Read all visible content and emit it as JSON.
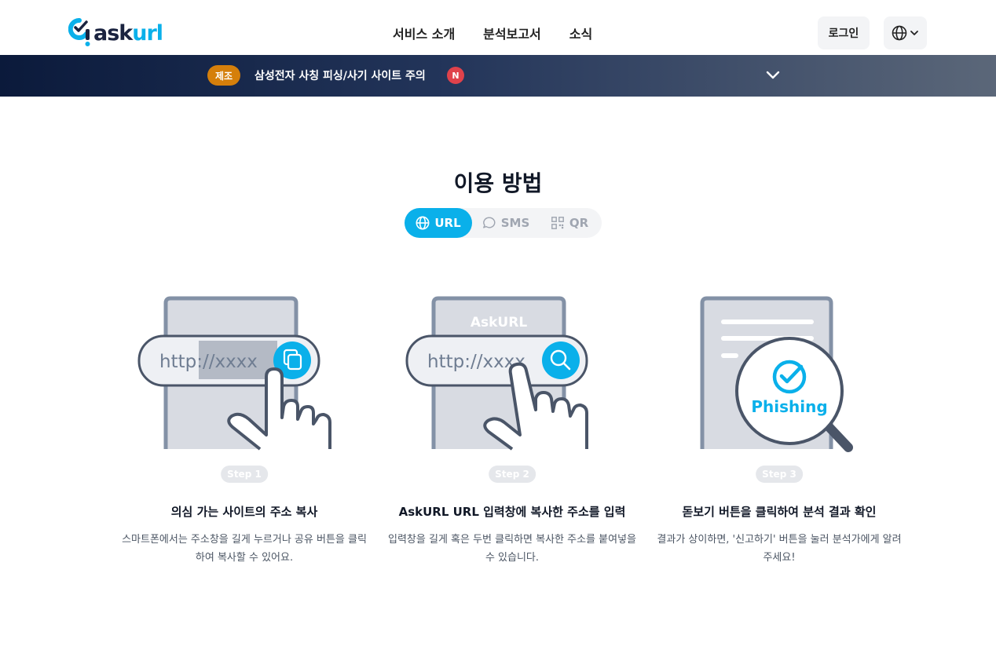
{
  "brand": {
    "logo_prefix": "ask",
    "logo_accent": "url",
    "accent_color": "#0ab0ea"
  },
  "nav": {
    "items": [
      "서비스 소개",
      "분석보고서",
      "소식"
    ]
  },
  "header": {
    "login_label": "로그인",
    "lang_icon": "globe-icon"
  },
  "banner": {
    "tag": "제조",
    "text": "삼성전자 사칭 피싱/사기 사이트 주의",
    "new_badge": "N"
  },
  "section": {
    "title": "이용 방법",
    "tabs": [
      {
        "label": "URL",
        "icon": "globe-icon",
        "active": true
      },
      {
        "label": "SMS",
        "icon": "chat-bubble-icon",
        "active": false
      },
      {
        "label": "QR",
        "icon": "qr-code-icon",
        "active": false
      }
    ]
  },
  "steps": [
    {
      "badge": "Step 1",
      "illus_text": "http://xxxx",
      "title": "의심 가는 사이트의 주소 복사",
      "desc": "스마트폰에서는 주소창을 길게 누르거나 공유 버튼을 클릭하여 복사할 수 있어요."
    },
    {
      "badge": "Step 2",
      "illus_header": "AskURL",
      "illus_text": "http://xxxx",
      "title": "AskURL URL 입력창에 복사한 주소를 입력",
      "desc": "입력창을 길게 혹은 두번 클릭하면 복사한 주소를 붙여넣을 수 있습니다."
    },
    {
      "badge": "Step 3",
      "illus_text": "Phishing",
      "title": "돋보기 버튼을 클릭하여 분석 결과 확인",
      "desc": "결과가 상이하면, '신고하기' 버튼을 눌러 분석가에게 알려주세요!"
    }
  ]
}
